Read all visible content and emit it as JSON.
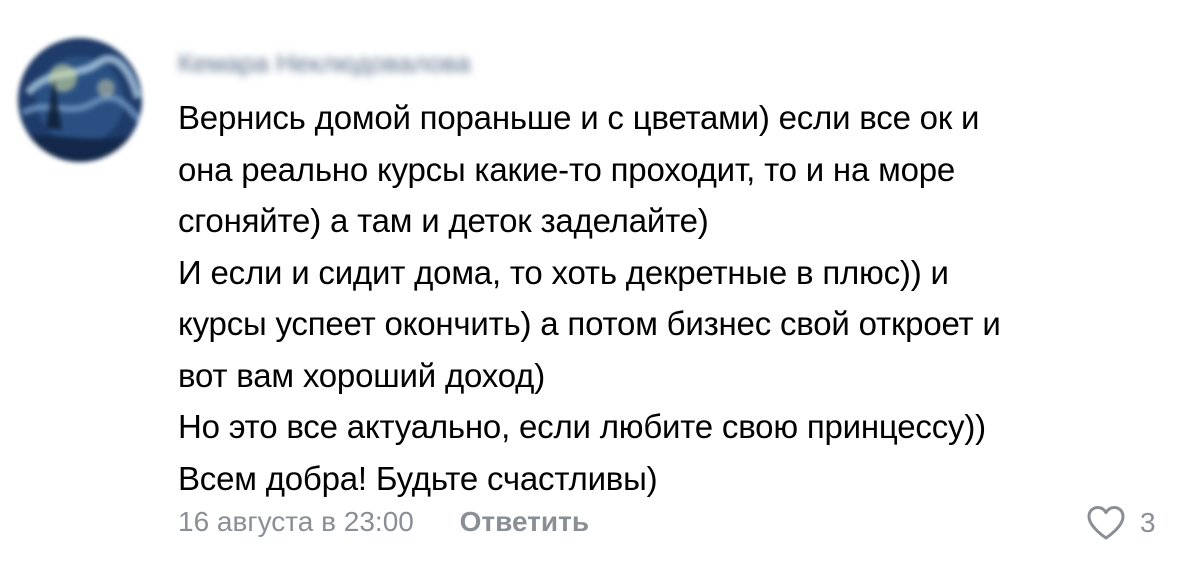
{
  "comment": {
    "author_name": "Кемара Неклюдовалова",
    "text_lines": [
      "Вернись домой пораньше и с цветами) если все ок и",
      "она реально курсы какие-то проходит, то и на море",
      "сгоняйте) а там и деток заделайте)",
      "И если и сидит дома, то хоть декретные в плюс)) и",
      "курсы успеет окончить) а потом бизнес свой откроет и",
      "вот вам хороший доход)",
      "Но это все актуально, если любите свою принцессу))",
      "Всем добра! Будьте счастливы)"
    ],
    "date": "16 августа в 23:00",
    "reply_label": "Ответить",
    "like_count": "3"
  },
  "colors": {
    "text": "#000000",
    "secondary": "#8a8f96",
    "author": "#5a6f8a"
  },
  "icons": {
    "avatar": "avatar-image",
    "like": "heart-outline-icon"
  }
}
